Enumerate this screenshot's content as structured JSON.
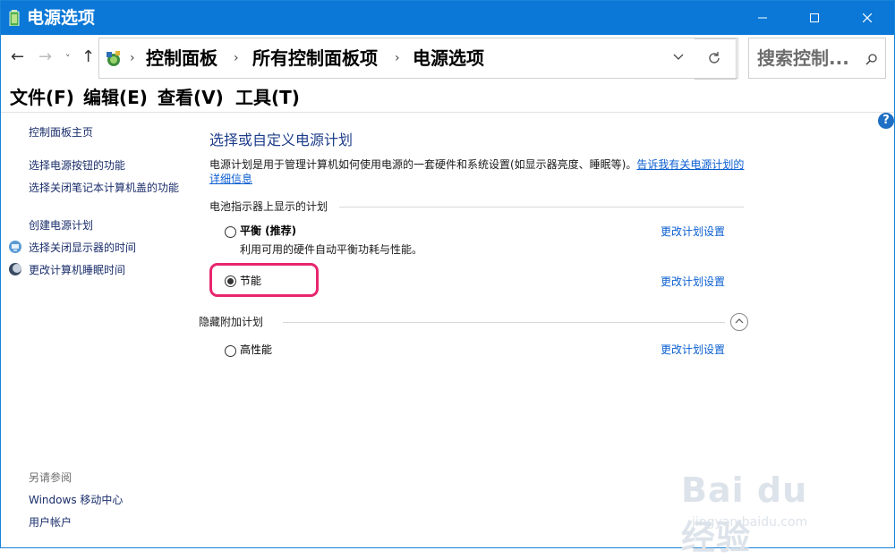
{
  "window": {
    "title": "电源选项",
    "accent_color": "#0b78d7",
    "controls": {
      "minimize": "minimize-icon",
      "maximize": "maximize-icon",
      "close": "close-icon"
    }
  },
  "nav": {
    "back": "←",
    "forward": "→",
    "history_dropdown": "˅",
    "up": "↑"
  },
  "address": {
    "icon": "control-panel-icon",
    "breadcrumbs": [
      "控制面板",
      "所有控制面板项",
      "电源选项"
    ],
    "separator": "›"
  },
  "search": {
    "text": "搜索控制..."
  },
  "menu": {
    "items": [
      "文件(F)",
      "编辑(E)",
      "查看(V)",
      "工具(T)"
    ]
  },
  "left_pane": {
    "home_link": "控制面板主页",
    "links": [
      {
        "label": "选择电源按钮的功能"
      },
      {
        "label": "选择关闭笔记本计算机盖的功能"
      },
      {
        "label": "创建电源计划"
      },
      {
        "label": "选择关闭显示器的时间",
        "icon": "display-icon"
      },
      {
        "label": "更改计算机睡眠时间",
        "icon": "moon-icon"
      }
    ],
    "see_also_title": "另请参阅",
    "see_also_links": [
      "Windows 移动中心",
      "用户帐户"
    ]
  },
  "main": {
    "help": "?",
    "heading": "选择或自定义电源计划",
    "description": "电源计划是用于管理计算机如何使用电源的一套硬件和系统设置(如显示器亮度、睡眠等)。",
    "description_link": "告诉我有关电源计划的详细信息",
    "battery_section": "电池指示器上显示的计划",
    "plans": [
      {
        "name": "平衡 (推荐)",
        "desc": "利用可用的硬件自动平衡功耗与性能。",
        "link": "更改计划设置",
        "selected": false
      },
      {
        "name": "节能",
        "desc": "",
        "link": "更改计划设置",
        "selected": true
      }
    ],
    "hidden_section": "隐藏附加计划",
    "hidden_plans": [
      {
        "name": "高性能",
        "link": "更改计划设置",
        "selected": false
      }
    ],
    "highlight_color": "#e8266d"
  },
  "watermark": {
    "logo": "Bai du 经验",
    "url": "jingyan.baidu.com"
  }
}
